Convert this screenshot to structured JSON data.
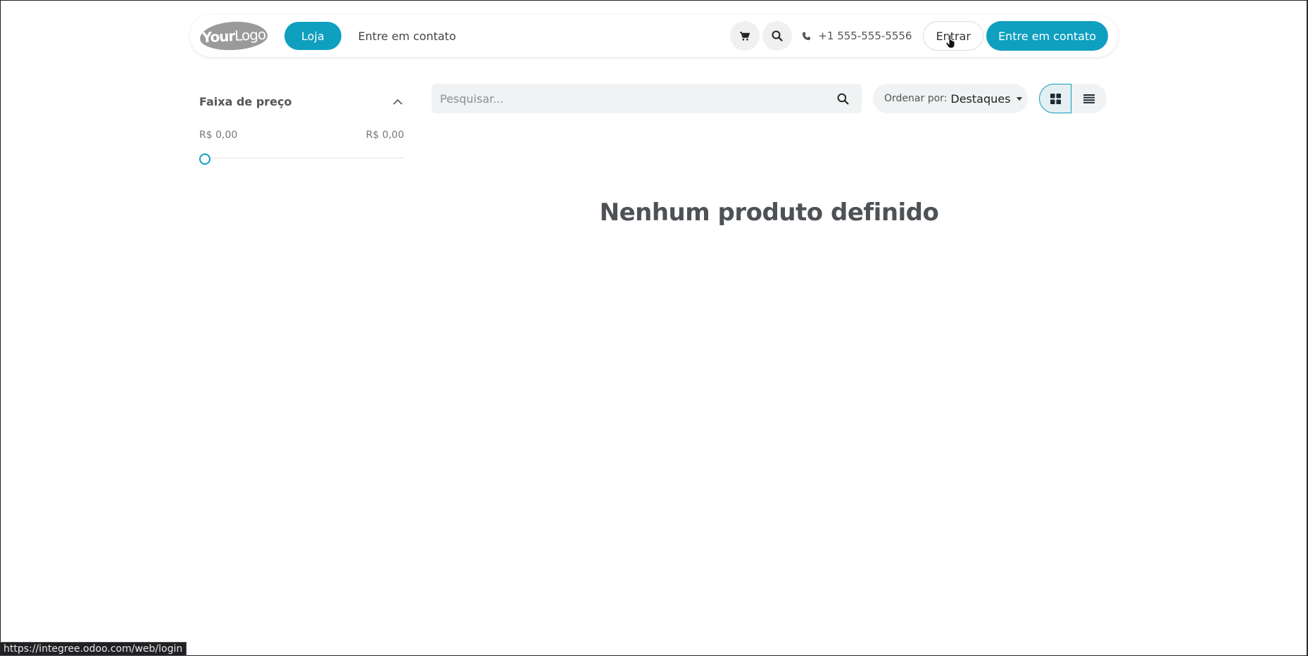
{
  "header": {
    "logo_bold": "Your",
    "logo_light": "Logo",
    "nav_shop": "Loja",
    "nav_contact": "Entre em contato",
    "phone": "+1 555-555-5556",
    "login_label": "Entrar",
    "cta_label": "Entre em contato",
    "icons": [
      "cart-icon",
      "search-icon",
      "phone-icon"
    ]
  },
  "sidebar": {
    "filter_title": "Faixa de preço",
    "price_min": "R$ 0,00",
    "price_max": "R$ 0,00"
  },
  "toolbar": {
    "search_placeholder": "Pesquisar...",
    "sort_label": "Ordenar por:",
    "sort_value": "Destaques",
    "view_options": [
      "grid",
      "list"
    ],
    "active_view": "grid"
  },
  "main": {
    "empty_message": "Nenhum produto definido"
  },
  "statusbar": {
    "url": "https://integree.odoo.com/web/login"
  },
  "colors": {
    "accent": "#0f9fbf",
    "toolbar_bg": "#f0f2f3",
    "text_muted": "#777777"
  }
}
